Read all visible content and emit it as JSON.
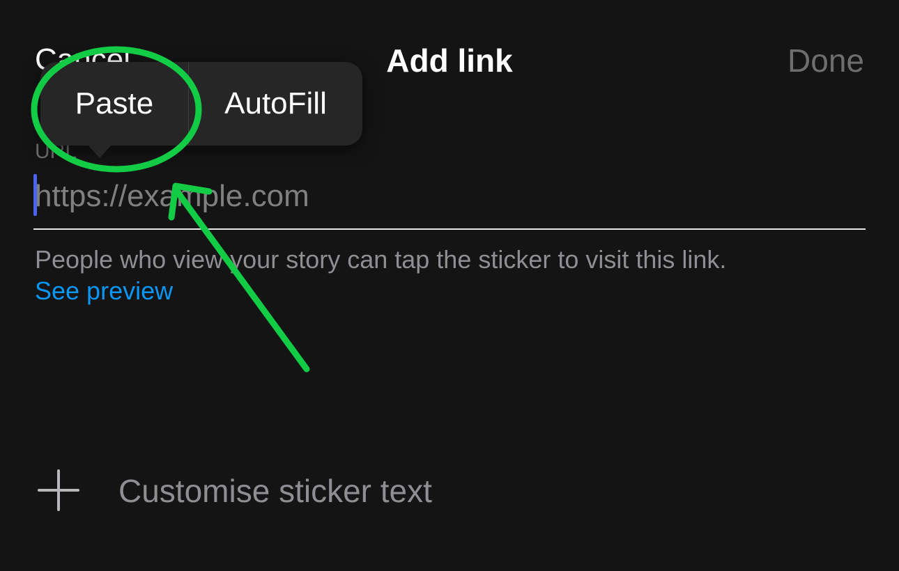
{
  "header": {
    "cancel_label": "Cancel",
    "title": "Add link",
    "done_label": "Done"
  },
  "url_field": {
    "label": "URL",
    "value": "",
    "placeholder": "https://example.com"
  },
  "help": {
    "text": "People who view your story can tap the sticker to visit this link.",
    "preview_link": "See preview"
  },
  "customise": {
    "icon": "plus-icon",
    "label": "Customise sticker text"
  },
  "edit_menu": {
    "items": [
      {
        "label": "Paste"
      },
      {
        "label": "AutoFill"
      }
    ]
  },
  "annotation": {
    "color": "#11cc44",
    "shapes": [
      "circle-around-paste",
      "arrow-pointing-to-paste"
    ]
  },
  "colors": {
    "background": "#141414",
    "accent_link": "#0a96f5",
    "caret": "#4a64f0",
    "muted_text": "#8e8e93"
  }
}
